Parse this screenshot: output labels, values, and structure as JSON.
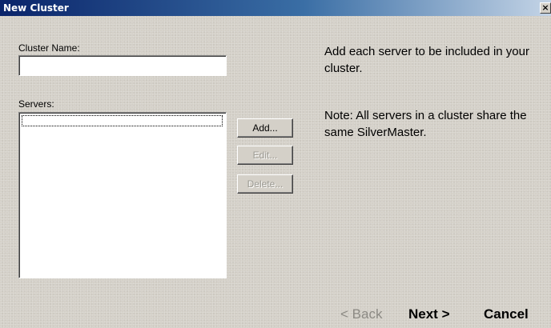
{
  "window": {
    "title": "New Cluster",
    "close_glyph": "×"
  },
  "form": {
    "cluster_name_label": "Cluster Name:",
    "cluster_name_value": "",
    "servers_label": "Servers:",
    "servers": []
  },
  "buttons": {
    "add": "Add...",
    "edit": "Edit...",
    "delete": "Delete..."
  },
  "info": {
    "instruction": "Add each server to be included in your cluster.",
    "note": "Note: All servers in a cluster share the same SilverMaster."
  },
  "wizard": {
    "back": "< Back",
    "next": "Next >",
    "cancel": "Cancel"
  },
  "icons": {
    "close": "close-icon"
  }
}
